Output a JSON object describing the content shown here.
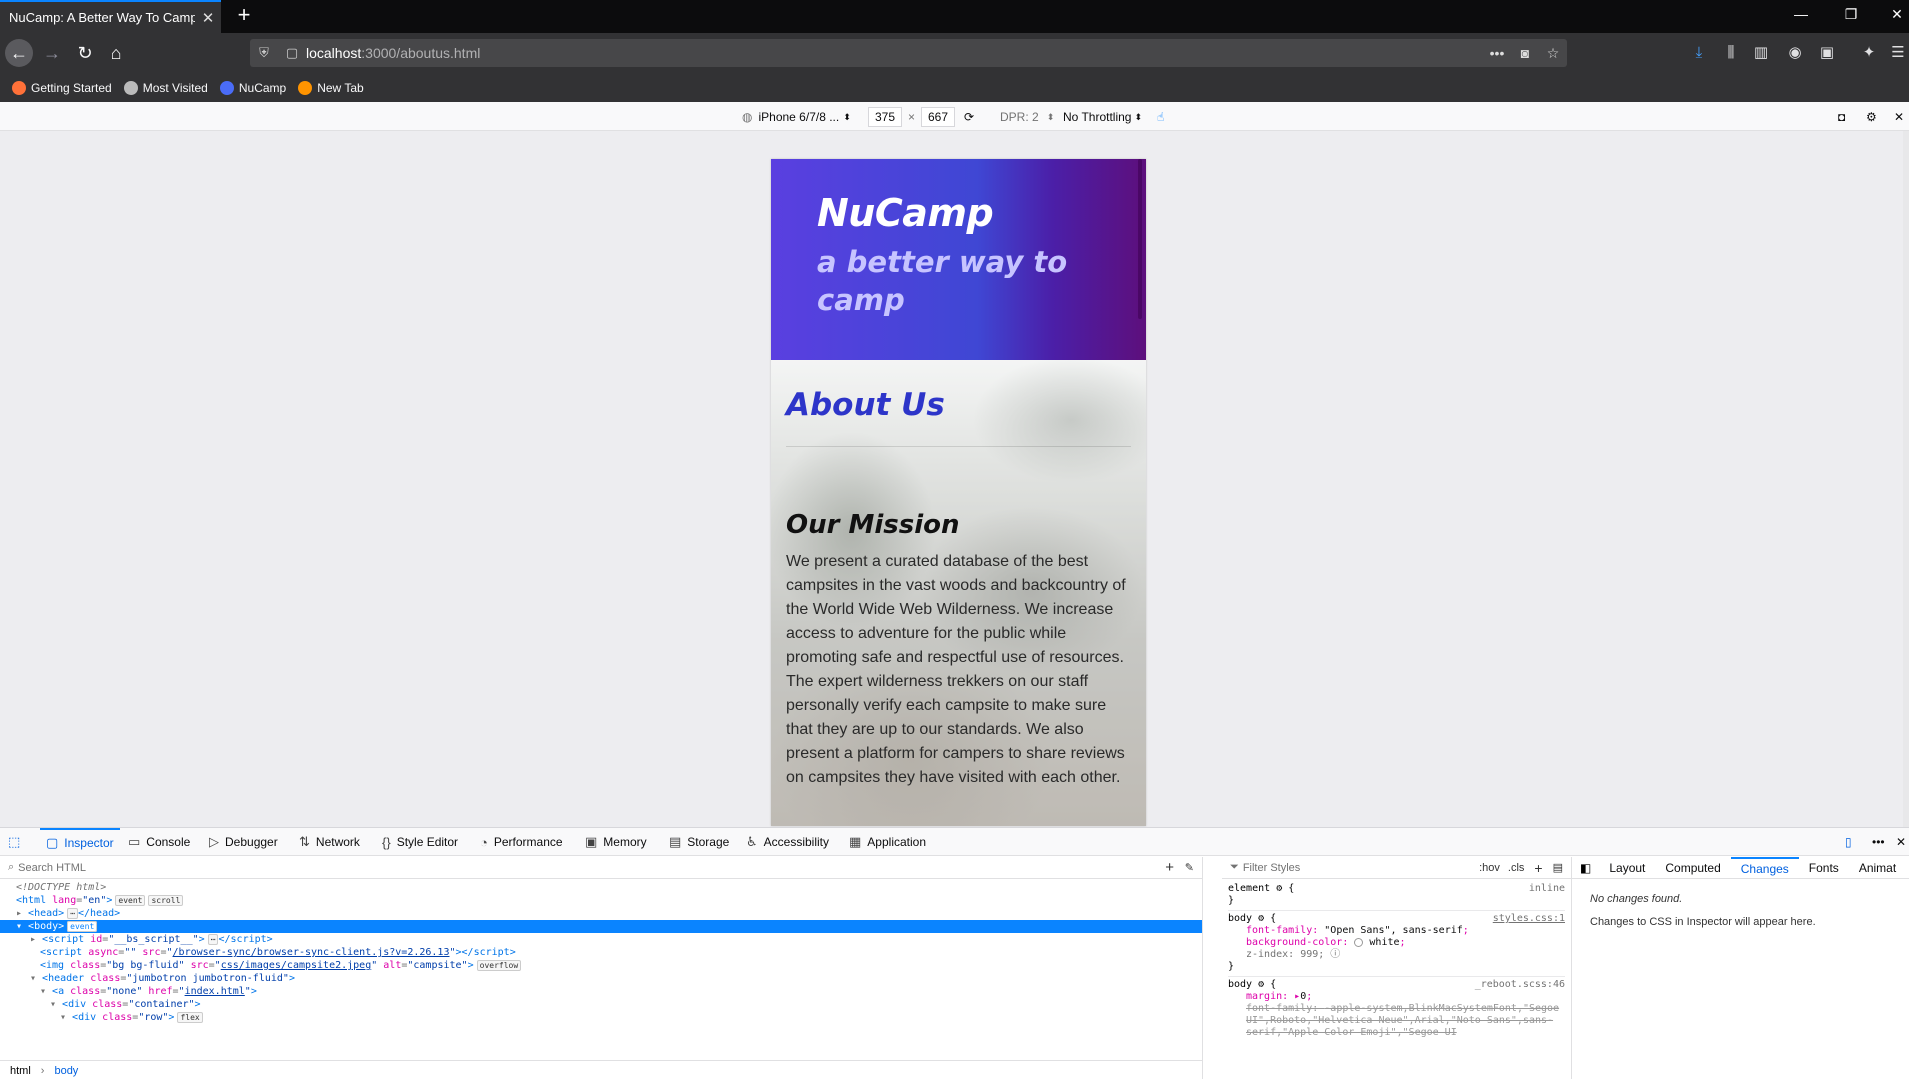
{
  "browser": {
    "tab_title": "NuCamp: A Better Way To Camp",
    "tab_close": "✕",
    "new_tab": "+",
    "url_host": "localhost",
    "url_path": ":3000/aboutus.html",
    "url_more": "•••",
    "window_controls": [
      "—",
      "❐",
      "✕"
    ]
  },
  "bookmarks": [
    {
      "label": "Getting Started",
      "color": "#ff7139"
    },
    {
      "label": "Most Visited",
      "color": "#bbbbbb"
    },
    {
      "label": "NuCamp",
      "color": "#4a6cf7"
    },
    {
      "label": "New Tab",
      "color": "#ff9400"
    }
  ],
  "rdm": {
    "device": "iPhone 6/7/8 ...",
    "width": "375",
    "times": "×",
    "height": "667",
    "dpr": "DPR: 2",
    "throttling": "No Throttling"
  },
  "page": {
    "brand": "NuCamp",
    "tagline": "a better way to camp",
    "about_title": "About Us",
    "mission_title": "Our Mission",
    "mission_text": "We present a curated database of the best campsites in the vast woods and backcountry of the World Wide Web Wilderness. We increase access to adventure for the public while promoting safe and respectful use of resources. The expert wilderness trekkers on our staff personally verify each campsite to make sure that they are up to our standards. We also present a platform for campers to share reviews on campsites they have visited with each other."
  },
  "devtools": {
    "tabs": [
      "Inspector",
      "Console",
      "Debugger",
      "Network",
      "Style Editor",
      "Performance",
      "Memory",
      "Storage",
      "Accessibility",
      "Application"
    ],
    "search_placeholder": "Search HTML",
    "filter_placeholder": "Filter Styles",
    "hov": ":hov",
    "cls": ".cls",
    "breadcrumb": [
      "html",
      "body"
    ],
    "side_tabs": [
      "Layout",
      "Computed",
      "Changes",
      "Fonts",
      "Animat"
    ],
    "changes_title": "No changes found.",
    "changes_text": "Changes to CSS in Inspector will appear here."
  },
  "css": {
    "element_selector": "element",
    "element_src": "inline",
    "body_src1": "styles.css:1",
    "body_font_family": "\"Open Sans\", sans-serif",
    "body_bg": "white",
    "body_zindex": "999",
    "body_src2": "_reboot.scss:46",
    "body_margin": "0",
    "body_font_family_old": "-apple-system,BlinkMacSystemFont,\"Segoe UI\",Roboto,\"Helvetica Neue\",Arial,\"Noto Sans\",sans-serif,\"Apple Color Emoji\",\"Segoe UI"
  }
}
